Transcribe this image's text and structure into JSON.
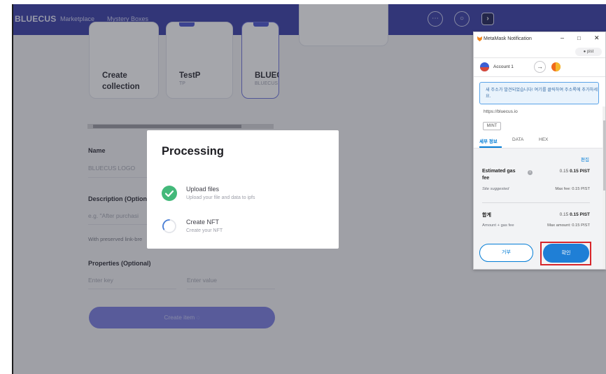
{
  "nav": {
    "logo": "BLUECUS",
    "links": [
      "Marketplace",
      "Mystery Boxes"
    ]
  },
  "collections": [
    {
      "title_line1": "Create",
      "title_line2": "collection",
      "sub": ""
    },
    {
      "title_line1": "TestP",
      "title_line2": "",
      "sub": "TP"
    },
    {
      "title_line1": "BLUEC",
      "title_line2": "",
      "sub": "BLUECUS"
    }
  ],
  "form": {
    "name_label": "Name",
    "name_value": "BLUECUS LOGO",
    "description_label": "Description (Option",
    "description_placeholder": "e.g. \"After purchasi",
    "preserved_text": "With preserved link-bre",
    "properties_label": "Properties (Optional)",
    "key_placeholder": "Enter key",
    "value_placeholder": "Enter value",
    "create_button": "Create item"
  },
  "modal": {
    "title": "Processing",
    "steps": [
      {
        "title": "Upload files",
        "subtitle": "Upload your file and data to ipfs",
        "status": "done"
      },
      {
        "title": "Create NFT",
        "subtitle": "Create your NFT",
        "status": "loading"
      }
    ]
  },
  "metamask": {
    "window_title": "MetaMask Notification",
    "network": "pist",
    "account": "Account 1",
    "notice": "새 주소가 발견되었습니다! 여기를 클릭하여 주소록에 추가하세요.",
    "origin": "https://bluecus.io",
    "method": "MINT",
    "tabs": [
      "세부 정보",
      "DATA",
      "HEX"
    ],
    "edit": "편집",
    "gas_label_line1": "Estimated gas",
    "gas_label_line2": "fee",
    "gas_small": "0.15",
    "gas_amount": "0.15 PIST",
    "site_suggested": "Site suggested",
    "max_fee": "Max fee: 0.15 PIST",
    "total_label": "합계",
    "total_small": "0.15",
    "total_amount": "0.15 PIST",
    "amount_gas": "Amount + gas fee",
    "max_amount": "Max amount: 0.15 PIST",
    "reject": "거부",
    "confirm": "확인"
  }
}
